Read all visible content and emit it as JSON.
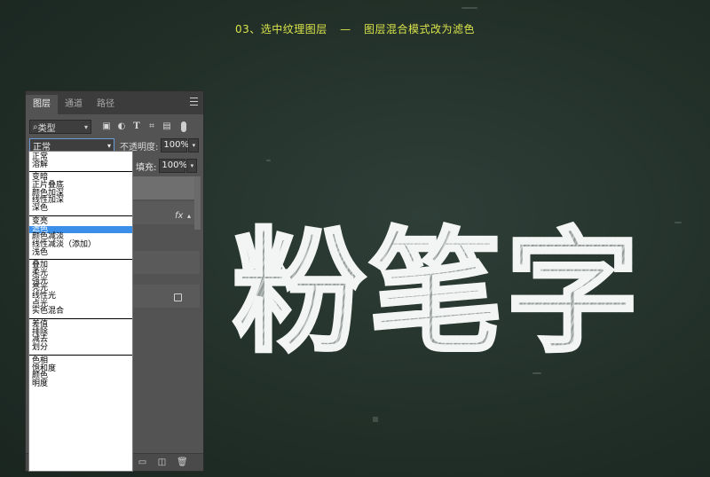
{
  "caption": {
    "step": "03、选中纹理图层",
    "dash": "—",
    "action": "图层混合模式改为滤色"
  },
  "panel": {
    "tabs": [
      {
        "label": "图层",
        "active": true
      },
      {
        "label": "通道",
        "active": false
      },
      {
        "label": "路径",
        "active": false
      }
    ],
    "filter": {
      "value": "类型",
      "search_glyph": "⌕"
    },
    "filter_icons": [
      "image-filter-icon",
      "adjustment-filter-icon",
      "type-filter-icon",
      "shape-filter-icon",
      "smart-object-filter-icon"
    ],
    "blend_mode": "正常",
    "opacity_label": "不透明度:",
    "opacity_value": "100%",
    "fill_label": "填充:",
    "fill_value": "100%",
    "fx": "fx"
  },
  "blend_menu": {
    "groups": [
      [
        "正常",
        "溶解"
      ],
      [
        "变暗",
        "正片叠底",
        "颜色加深",
        "线性加深",
        "深色"
      ],
      [
        "变亮",
        "滤色",
        "颜色减淡",
        "线性减淡（添加）",
        "浅色"
      ],
      [
        "叠加",
        "柔光",
        "强光",
        "亮光",
        "线性光",
        "点光",
        "实色混合"
      ],
      [
        "差值",
        "排除",
        "减去",
        "划分"
      ],
      [
        "色相",
        "饱和度",
        "颜色",
        "明度"
      ]
    ],
    "selected": "滤色"
  },
  "artwork": {
    "text": "粉笔字"
  },
  "colors": {
    "caption": "#d9e34a",
    "board": "#223029",
    "selection": "#3b8fe8"
  }
}
